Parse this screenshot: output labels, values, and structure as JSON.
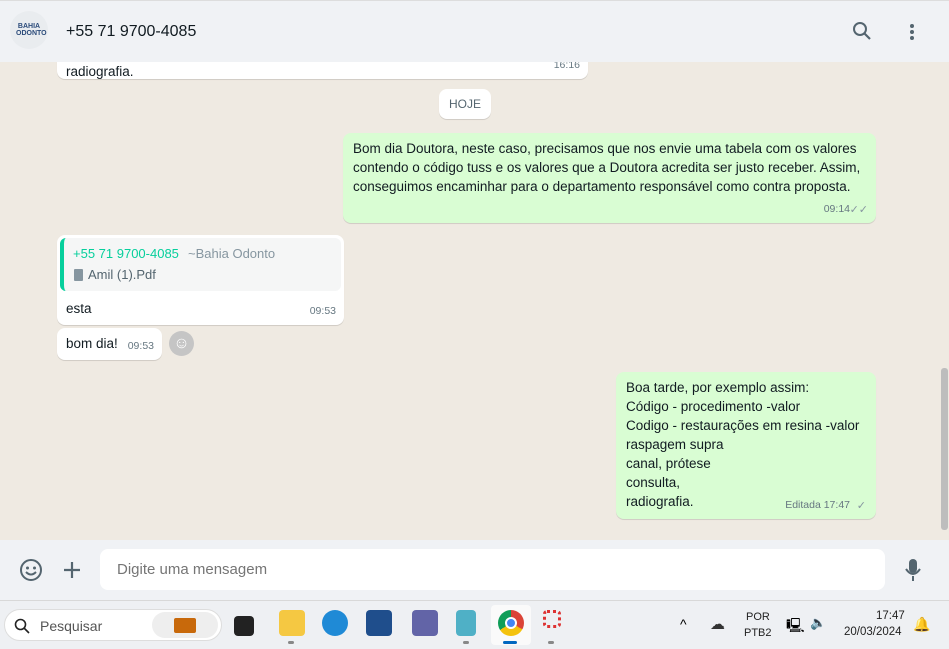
{
  "header": {
    "avatar_text": "BAHIA ODONTO",
    "contact": "+55 71 9700-4085",
    "search_icon": "search-icon",
    "menu_icon": "more-vertical-icon"
  },
  "messages": [
    {
      "dir": "in",
      "text": "radiografia.",
      "time": "16:16"
    },
    {
      "type": "date",
      "text": "HOJE"
    },
    {
      "dir": "out",
      "text": "Bom dia Doutora, neste caso, precisamos que nos envie uma tabela com os valores  contendo o código tuss e os valores que a Doutora acredita ser justo receber. Assim, conseguimos encaminhar para o departamento responsável como contra proposta.",
      "time": "09:14",
      "status": "read"
    },
    {
      "dir": "in",
      "quote": {
        "sender": "+55 71 9700-4085",
        "name": "~Bahia Odonto",
        "file": "Amil (1).Pdf"
      },
      "text": "esta",
      "time": "09:53"
    },
    {
      "dir": "in",
      "text": "bom dia!",
      "time": "09:53"
    },
    {
      "dir": "out",
      "lines": [
        "Boa tarde, por exemplo assim:",
        "Código - procedimento -valor",
        "Codigo - restaurações em resina -valor",
        "raspagem supra",
        "canal, prótese",
        "consulta,",
        "radiografia."
      ],
      "time": "Editada 17:47",
      "status": "sent"
    }
  ],
  "composer": {
    "placeholder": "Digite uma mensagem"
  },
  "taskbar": {
    "search": "Pesquisar",
    "lang1": "POR",
    "lang2": "PTB2",
    "time": "17:47",
    "date": "20/03/2024"
  },
  "colors": {
    "accent": "#06cf9c",
    "outgoing": "#d9fdd3",
    "bg": "#efeae2"
  }
}
